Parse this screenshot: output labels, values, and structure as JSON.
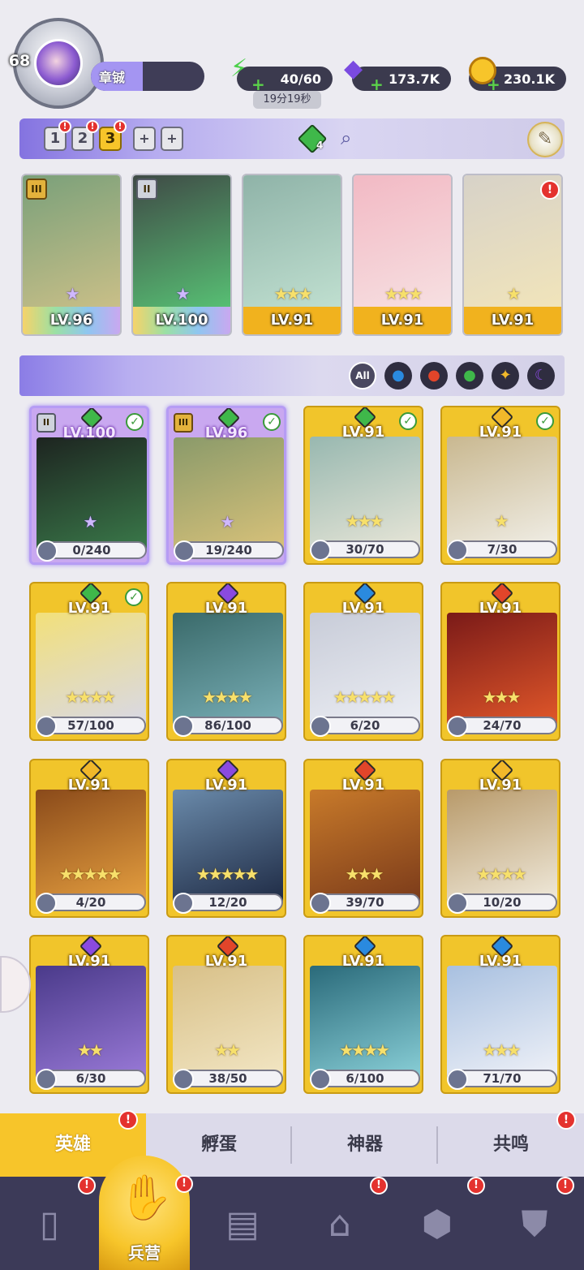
{
  "player": {
    "level": "68",
    "name": "章铖"
  },
  "resources": {
    "energy": {
      "icon": "lightning-icon",
      "value": "40/60",
      "timer": "19分19秒"
    },
    "gems": {
      "icon": "gem-icon",
      "value": "173.7K"
    },
    "coins": {
      "icon": "coin-icon",
      "value": "230.1K"
    }
  },
  "team": {
    "slots": [
      "1",
      "2",
      "3"
    ],
    "active_slot": "3",
    "add_labels": [
      "+",
      "+"
    ],
    "gem_count": "4"
  },
  "team_cards": [
    {
      "tier": "III",
      "level": "LV.96",
      "stars": "★",
      "element": "nature",
      "frame": "rainbow",
      "art": [
        "#7aa07a",
        "#d6c48a"
      ]
    },
    {
      "tier": "II",
      "level": "LV.100",
      "stars": "★",
      "element": "nature",
      "frame": "rainbow",
      "art": [
        "#3f4a46",
        "#5bd27b"
      ]
    },
    {
      "tier": "",
      "level": "LV.91",
      "stars": "★★★",
      "element": "nature",
      "frame": "gold",
      "art": [
        "#8fb3a8",
        "#c7e6d6"
      ]
    },
    {
      "tier": "",
      "level": "LV.91",
      "stars": "★★★",
      "element": "nature",
      "frame": "gold",
      "art": [
        "#f2b9c4",
        "#f7e6e6"
      ]
    },
    {
      "tier": "",
      "level": "LV.91",
      "stars": "★",
      "element": "light",
      "frame": "gold",
      "art": [
        "#d7d2c8",
        "#f5e7b8"
      ],
      "alert": "!"
    }
  ],
  "filters": [
    "All",
    "water",
    "fire",
    "nature",
    "light",
    "dark"
  ],
  "heroes": [
    {
      "level": "LV.100",
      "element": "nature",
      "fragments": "0/240",
      "tier": "II",
      "check": true,
      "style": "purple",
      "stars": "★",
      "art": [
        "#1d2420",
        "#3a7a4a"
      ]
    },
    {
      "level": "LV.96",
      "element": "nature",
      "fragments": "19/240",
      "tier": "III",
      "check": true,
      "style": "purple",
      "stars": "★",
      "art": [
        "#8a9a6a",
        "#d9c27a"
      ]
    },
    {
      "level": "LV.91",
      "element": "nature",
      "fragments": "30/70",
      "check": true,
      "stars": "★★★",
      "art": [
        "#98b8b0",
        "#e8e6d8"
      ]
    },
    {
      "level": "LV.91",
      "element": "light",
      "fragments": "7/30",
      "check": true,
      "stars": "★",
      "art": [
        "#c9b890",
        "#f1efe8"
      ]
    },
    {
      "level": "LV.91",
      "element": "nature",
      "fragments": "57/100",
      "check": true,
      "stars": "★★★★",
      "art": [
        "#f2e07a",
        "#d8d8e8"
      ]
    },
    {
      "level": "LV.91",
      "element": "dark",
      "fragments": "86/100",
      "stars": "★★★★",
      "art": [
        "#3a6a6a",
        "#7ab0b8"
      ]
    },
    {
      "level": "LV.91",
      "element": "water",
      "fragments": "6/20",
      "stars": "★★★★★",
      "art": [
        "#c8ccd8",
        "#eceef4"
      ]
    },
    {
      "level": "LV.91",
      "element": "fire",
      "fragments": "24/70",
      "stars": "★★★",
      "art": [
        "#7a1a18",
        "#e2582a"
      ]
    },
    {
      "level": "LV.91",
      "element": "light",
      "fragments": "4/20",
      "stars": "★★★★★",
      "art": [
        "#8a4a1a",
        "#e6a040"
      ]
    },
    {
      "level": "LV.91",
      "element": "dark",
      "fragments": "12/20",
      "stars": "★★★★★",
      "art": [
        "#6a8aaa",
        "#1e2a44"
      ]
    },
    {
      "level": "LV.91",
      "element": "fire",
      "fragments": "39/70",
      "stars": "★★★",
      "art": [
        "#c87a2a",
        "#7a3a1a"
      ]
    },
    {
      "level": "LV.91",
      "element": "light",
      "fragments": "10/20",
      "stars": "★★★★",
      "art": [
        "#b89a6a",
        "#f0eadc"
      ]
    },
    {
      "level": "LV.91",
      "element": "dark",
      "fragments": "6/30",
      "stars": "★★",
      "art": [
        "#4a3a8a",
        "#9a7ad8"
      ]
    },
    {
      "level": "LV.91",
      "element": "fire",
      "fragments": "38/50",
      "stars": "★★",
      "art": [
        "#d8c088",
        "#f2e6c4"
      ]
    },
    {
      "level": "LV.91",
      "element": "water",
      "fragments": "6/100",
      "stars": "★★★★",
      "art": [
        "#2a6a7a",
        "#8ad0d8"
      ]
    },
    {
      "level": "LV.91",
      "element": "water",
      "fragments": "71/70",
      "stars": "★★★",
      "art": [
        "#a8c0e0",
        "#f0f2f8"
      ]
    }
  ],
  "tabs": [
    "英雄",
    "孵蛋",
    "神器",
    "共鸣"
  ],
  "active_tab": "英雄",
  "nav": {
    "items": [
      "cards-icon",
      "barracks-icon",
      "book-icon",
      "castle-icon",
      "guild-icon",
      "banner-icon"
    ],
    "active_label": "兵营"
  },
  "colors": {
    "nature": "#3fb84a",
    "water": "#2a8adf",
    "fire": "#e2452a",
    "light": "#f1b82a",
    "dark": "#8a4ae0",
    "gold": "#f1c52b",
    "accent": "#a495f2",
    "alert": "#e4322e"
  }
}
